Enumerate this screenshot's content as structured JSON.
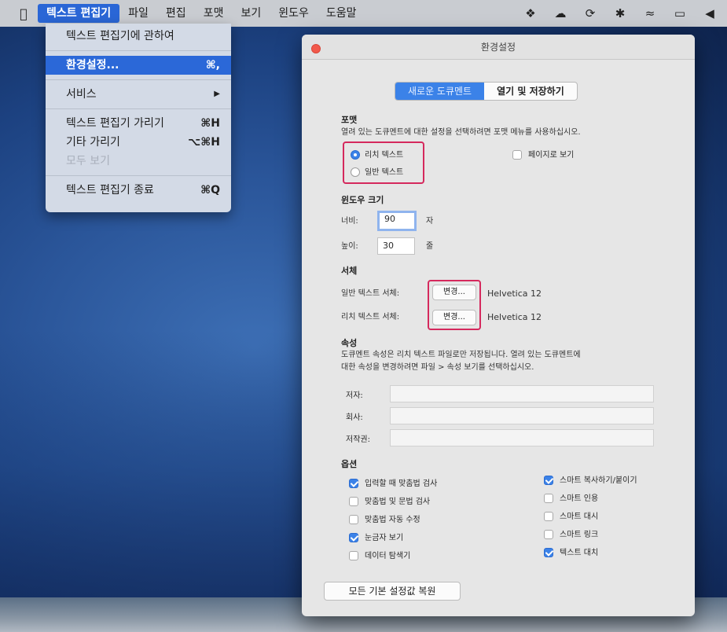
{
  "menubar": {
    "app_menu": "텍스트 편집기",
    "menus": [
      "파일",
      "편집",
      "포맷",
      "보기",
      "윈도우",
      "도움말"
    ]
  },
  "dropdown": {
    "items": [
      {
        "label": "텍스트 편집기에 관하여",
        "shortcut": ""
      },
      {
        "label": "환경설정...",
        "shortcut": "⌘,"
      },
      {
        "label": "서비스",
        "shortcut": "▶"
      },
      {
        "label": "텍스트 편집기 가리기",
        "shortcut": "⌘H"
      },
      {
        "label": "기타 가리기",
        "shortcut": "⌥⌘H"
      },
      {
        "label": "모두 보기",
        "shortcut": ""
      },
      {
        "label": "텍스트 편집기 종료",
        "shortcut": "⌘Q"
      }
    ]
  },
  "window": {
    "title": "환경설정",
    "tabs": [
      "새로운 도큐멘트",
      "열기 및 저장하기"
    ],
    "format": {
      "heading": "포맷",
      "description": "열려 있는 도큐멘트에 대한 설정을 선택하려면 포맷 메뉴를 사용하십시오.",
      "rich_text": "리치 텍스트",
      "plain_text": "일반 텍스트",
      "wrap_to_page": "페이지로 보기"
    },
    "window_size": {
      "heading": "윈도우 크기",
      "width_label": "너비:",
      "width_value": "90",
      "width_unit": "자",
      "height_label": "높이:",
      "height_value": "30",
      "height_unit": "줄"
    },
    "font": {
      "heading": "서체",
      "plain_label": "일반 텍스트 서체:",
      "rich_label": "리치 텍스트 서체:",
      "change_button": "변경...",
      "plain_font": "Helvetica 12",
      "rich_font": "Helvetica 12"
    },
    "properties": {
      "heading": "속성",
      "description_line1": "도큐멘트 속성은 리치 텍스트 파일로만 저장됩니다. 열려 있는 도큐멘트에",
      "description_line2": "대한 속성을 변경하려면 파일 > 속성 보기를 선택하십시오.",
      "author": "저자:",
      "company": "회사:",
      "copyright": "저작권:"
    },
    "options": {
      "heading": "옵션",
      "left": [
        {
          "label": "입력할 때 맞춤법 검사",
          "checked": true
        },
        {
          "label": "맞춤법 및 문법 검사",
          "checked": false
        },
        {
          "label": "맞춤법 자동 수정",
          "checked": false
        },
        {
          "label": "눈금자 보기",
          "checked": true
        },
        {
          "label": "데이터 탐색기",
          "checked": false
        }
      ],
      "right": [
        {
          "label": "스마트 복사하기/붙이기",
          "checked": true
        },
        {
          "label": "스마트 인용",
          "checked": false
        },
        {
          "label": "스마트 대시",
          "checked": false
        },
        {
          "label": "스마트 링크",
          "checked": false
        },
        {
          "label": "텍스트 대치",
          "checked": true
        }
      ]
    },
    "restore_button": "모든 기본 설정값 복원"
  },
  "colors": {
    "accent": "#3b82e8",
    "highlight_box": "#d5295d",
    "menu_selected": "#2b68d8"
  }
}
